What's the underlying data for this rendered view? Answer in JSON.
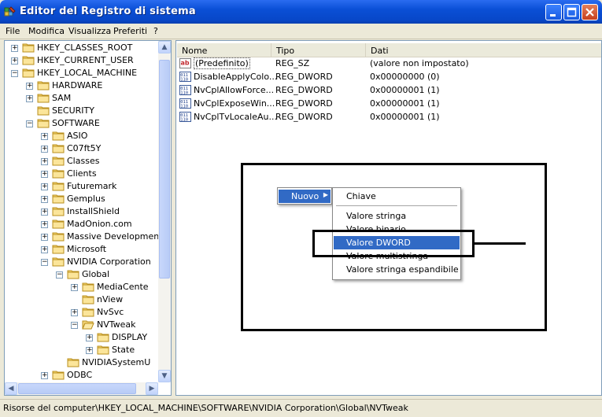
{
  "window": {
    "title": "Editor del Registro di sistema"
  },
  "menubar": [
    "File",
    "Modifica",
    "Visualizza",
    "Preferiti",
    "?"
  ],
  "tree": [
    {
      "label": "HKEY_CLASSES_ROOT",
      "depth": 0,
      "exp": "+",
      "sel": false
    },
    {
      "label": "HKEY_CURRENT_USER",
      "depth": 0,
      "exp": "+",
      "sel": false
    },
    {
      "label": "HKEY_LOCAL_MACHINE",
      "depth": 0,
      "exp": "-",
      "sel": false
    },
    {
      "label": "HARDWARE",
      "depth": 1,
      "exp": "+",
      "sel": false
    },
    {
      "label": "SAM",
      "depth": 1,
      "exp": "+",
      "sel": false
    },
    {
      "label": "SECURITY",
      "depth": 1,
      "exp": "",
      "sel": false
    },
    {
      "label": "SOFTWARE",
      "depth": 1,
      "exp": "-",
      "sel": false
    },
    {
      "label": "ASIO",
      "depth": 2,
      "exp": "+",
      "sel": false
    },
    {
      "label": "C07ft5Y",
      "depth": 2,
      "exp": "+",
      "sel": false
    },
    {
      "label": "Classes",
      "depth": 2,
      "exp": "+",
      "sel": false
    },
    {
      "label": "Clients",
      "depth": 2,
      "exp": "+",
      "sel": false
    },
    {
      "label": "Futuremark",
      "depth": 2,
      "exp": "+",
      "sel": false
    },
    {
      "label": "Gemplus",
      "depth": 2,
      "exp": "+",
      "sel": false
    },
    {
      "label": "InstallShield",
      "depth": 2,
      "exp": "+",
      "sel": false
    },
    {
      "label": "MadOnion.com",
      "depth": 2,
      "exp": "+",
      "sel": false
    },
    {
      "label": "Massive Developmen",
      "depth": 2,
      "exp": "+",
      "sel": false
    },
    {
      "label": "Microsoft",
      "depth": 2,
      "exp": "+",
      "sel": false
    },
    {
      "label": "NVIDIA Corporation",
      "depth": 2,
      "exp": "-",
      "sel": false
    },
    {
      "label": "Global",
      "depth": 3,
      "exp": "-",
      "sel": false
    },
    {
      "label": "MediaCente",
      "depth": 4,
      "exp": "+",
      "sel": false
    },
    {
      "label": "nView",
      "depth": 4,
      "exp": "",
      "sel": false
    },
    {
      "label": "NvSvc",
      "depth": 4,
      "exp": "+",
      "sel": false
    },
    {
      "label": "NVTweak",
      "depth": 4,
      "exp": "-",
      "sel": true
    },
    {
      "label": "DISPLAY",
      "depth": 5,
      "exp": "+",
      "sel": false
    },
    {
      "label": "State",
      "depth": 5,
      "exp": "+",
      "sel": false
    },
    {
      "label": "NVIDIASystemU",
      "depth": 3,
      "exp": "",
      "sel": false
    },
    {
      "label": "ODBC",
      "depth": 2,
      "exp": "+",
      "sel": false
    }
  ],
  "list": {
    "headers": [
      "Nome",
      "Tipo",
      "Dati"
    ],
    "rows": [
      {
        "name": "(Predefinito)",
        "type": "REG_SZ",
        "data": "(valore non impostato)",
        "icon": "string-value-icon"
      },
      {
        "name": "DisableApplyColo...",
        "type": "REG_DWORD",
        "data": "0x00000000 (0)",
        "icon": "dword-value-icon"
      },
      {
        "name": "NvCplAllowForce...",
        "type": "REG_DWORD",
        "data": "0x00000001 (1)",
        "icon": "dword-value-icon"
      },
      {
        "name": "NvCplExposeWin...",
        "type": "REG_DWORD",
        "data": "0x00000001 (1)",
        "icon": "dword-value-icon"
      },
      {
        "name": "NvCplTvLocaleAu...",
        "type": "REG_DWORD",
        "data": "0x00000001 (1)",
        "icon": "dword-value-icon"
      }
    ]
  },
  "context_menu": {
    "parent": "Nuovo",
    "items": [
      "Chiave",
      "Valore stringa",
      "Valore binario",
      "Valore DWORD",
      "Valore multistringa",
      "Valore stringa espandibile"
    ],
    "highlighted": "Valore DWORD"
  },
  "statusbar": {
    "path": "Risorse del computer\\HKEY_LOCAL_MACHINE\\SOFTWARE\\NVIDIA Corporation\\Global\\NVTweak"
  }
}
